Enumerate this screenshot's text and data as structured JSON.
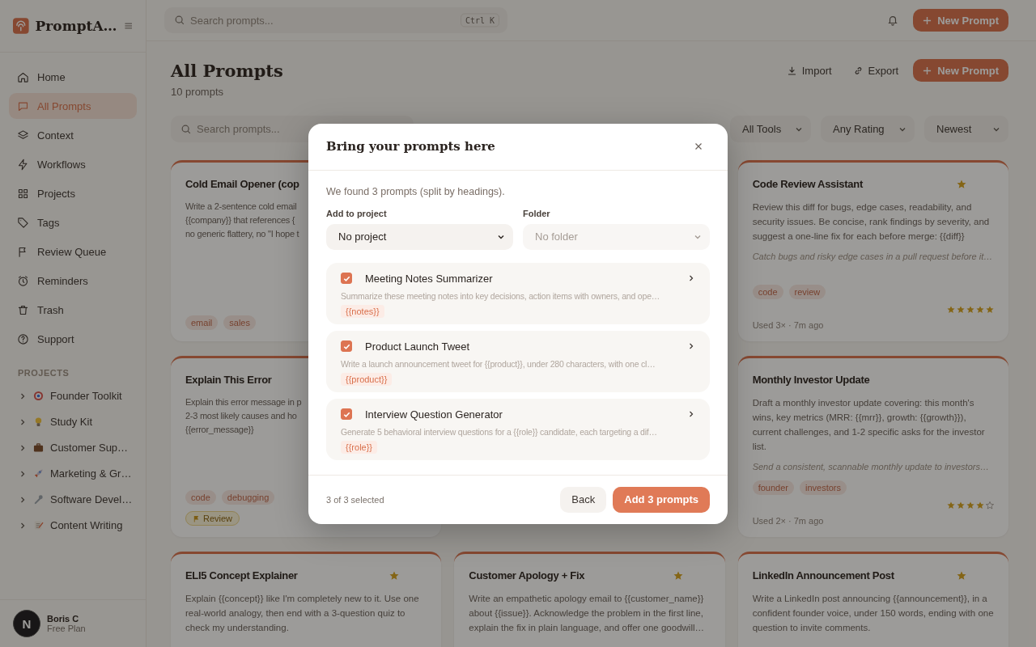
{
  "app": {
    "name": "PromptA…"
  },
  "topbar": {
    "search_placeholder": "Search prompts...",
    "shortcut": "Ctrl K",
    "new_button": "New Prompt"
  },
  "sidebar": {
    "items": [
      {
        "label": "Home",
        "selected": false
      },
      {
        "label": "All Prompts",
        "selected": true
      },
      {
        "label": "Context",
        "selected": false
      },
      {
        "label": "Workflows",
        "selected": false
      },
      {
        "label": "Projects",
        "selected": false
      },
      {
        "label": "Tags",
        "selected": false
      },
      {
        "label": "Review Queue",
        "selected": false
      },
      {
        "label": "Reminders",
        "selected": false
      },
      {
        "label": "Trash",
        "selected": false
      },
      {
        "label": "Support",
        "selected": false
      }
    ],
    "projects_heading": "PROJECTS",
    "projects": [
      {
        "label": "Founder Toolkit",
        "expanded": false
      },
      {
        "label": "Study Kit",
        "expanded": false
      },
      {
        "label": "Customer Sup…",
        "expanded": false
      },
      {
        "label": "Marketing & Gr…",
        "expanded": false
      },
      {
        "label": "Software Devel…",
        "expanded": false
      },
      {
        "label": "Content Writing",
        "expanded": false
      }
    ],
    "user": {
      "avatar_letter": "N",
      "name": "Boris C",
      "plan": "Free Plan"
    }
  },
  "header": {
    "title": "All Prompts",
    "count": "10 prompts",
    "actions": [
      "Import",
      "Export"
    ],
    "new_button": "New Prompt"
  },
  "filters": {
    "search_placeholder": "Search prompts...",
    "dropdowns": [
      "All Tools",
      "Any Rating",
      "Newest"
    ]
  },
  "columns": [
    {
      "cards": [
        {
          "title": "Cold Email Opener (cop",
          "lines": [
            "Write a 2-sentence cold email",
            "{{company}} that references {",
            "no generic flattery, no \"I hope t"
          ],
          "tags": [
            "email",
            "sales"
          ]
        },
        {
          "title": "Explain This Error",
          "lines": [
            "Explain this error message in p",
            "2-3 most likely causes and ho",
            "{{error_message}}"
          ],
          "tags": [
            "code",
            "debugging"
          ],
          "badge": "Review"
        },
        {
          "title": "ELI5 Concept Explainer",
          "favorite": true,
          "description": "Explain {{concept}} like I'm completely new to it. Use one real-world analogy, then end with a 3-question quiz to check my understanding."
        }
      ]
    },
    {
      "cards": [
        {
          "title": "Customer Apology + Fix",
          "favorite": true,
          "description": "Write an empathetic apology email to {{customer_name}} about {{issue}}. Acknowledge the problem in the first line, explain the fix in plain language, and offer one goodwill…"
        }
      ]
    },
    {
      "cards": [
        {
          "title": "Code Review Assistant",
          "favorite": true,
          "description": "Review this diff for bugs, edge cases, readability, and security issues. Be concise, rank findings by severity, and suggest a one-line fix for each before merge: {{diff}}",
          "summary": "Catch bugs and risky edge cases in a pull request before it…",
          "tags": [
            "code",
            "review"
          ],
          "stars": 5,
          "usage": "Used 3× · 7m ago"
        },
        {
          "title": "Monthly Investor Update",
          "favorite": false,
          "description": "Draft a monthly investor update covering: this month's wins, key metrics (MRR: {{mrr}}, growth: {{growth}}), current challenges, and 1-2 specific asks for the investor list.",
          "summary": "Send a consistent, scannable monthly update to investors…",
          "tags": [
            "founder",
            "investors"
          ],
          "stars": 4,
          "usage": "Used 2× · 7m ago"
        },
        {
          "title": "LinkedIn Announcement Post",
          "favorite": true,
          "description": "Write a LinkedIn post announcing {{announcement}}, in a confident founder voice, under 150 words, ending with one question to invite comments."
        }
      ]
    }
  ],
  "modal": {
    "title": "Bring your prompts here",
    "info": "We found 3 prompts (split by headings).",
    "selects": [
      {
        "label": "Add to project",
        "value": "No project",
        "disabled": false
      },
      {
        "label": "Folder",
        "value": "No folder",
        "disabled": true
      }
    ],
    "items": [
      {
        "title": "Meeting Notes Summarizer",
        "checked": true,
        "preview": "Summarize these meeting notes into key decisions, action items with owners, and ope…",
        "variables": [
          "{{notes}}"
        ]
      },
      {
        "title": "Product Launch Tweet",
        "checked": true,
        "preview": "Write a launch announcement tweet for {{product}}, under 280 characters, with one cl…",
        "variables": [
          "{{product}}"
        ]
      },
      {
        "title": "Interview Question Generator",
        "checked": true,
        "preview": "Generate 5 behavioral interview questions for a {{role}} candidate, each targeting a dif…",
        "variables": [
          "{{role}}"
        ]
      }
    ],
    "selection": "3 of 3 selected",
    "back": "Back",
    "confirm": "Add 3 prompts"
  }
}
